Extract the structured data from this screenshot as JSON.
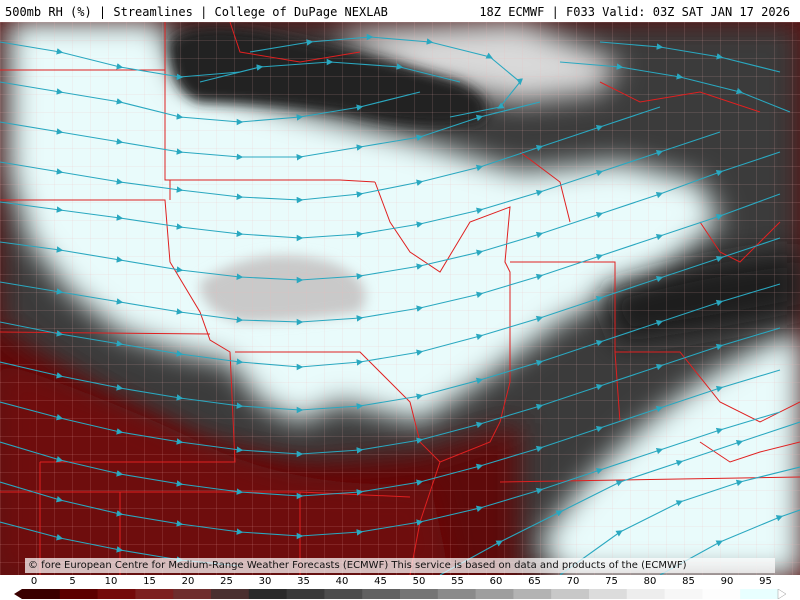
{
  "header": {
    "left": "500mb RH (%) | Streamlines | College of DuPage NEXLAB",
    "right": "18Z ECMWF | F033 Valid: 03Z SAT JAN 17 2026"
  },
  "copyright": "© fore European Centre for Medium-Range Weather Forecasts (ECMWF) This service is based on data and products of the (ECMWF)",
  "legend": {
    "ticks": [
      "0",
      "5",
      "10",
      "15",
      "20",
      "25",
      "30",
      "35",
      "40",
      "45",
      "50",
      "55",
      "60",
      "65",
      "70",
      "75",
      "80",
      "85",
      "90",
      "95"
    ],
    "colors": [
      "#3a0000",
      "#5c0000",
      "#740a0a",
      "#7d2020",
      "#6e2e2e",
      "#4a3030",
      "#2a2a2a",
      "#3a3a3a",
      "#4d4d4d",
      "#616161",
      "#757575",
      "#8a8a8a",
      "#9e9e9e",
      "#b3b3b3",
      "#c8c8c8",
      "#dcdcdc",
      "#ededed",
      "#f7f7f7",
      "#fdfdfd",
      "#e8ffff"
    ]
  },
  "map": {
    "field": "500mb RH (%)",
    "overlay": "Streamlines",
    "colors": {
      "dry": "#6a0c0c",
      "moist": "#f4ffff",
      "mid": "#3a3a3a",
      "streamline": "#2aa8c0",
      "state_border": "#e02020",
      "county_border": "#f4aaaa"
    }
  }
}
